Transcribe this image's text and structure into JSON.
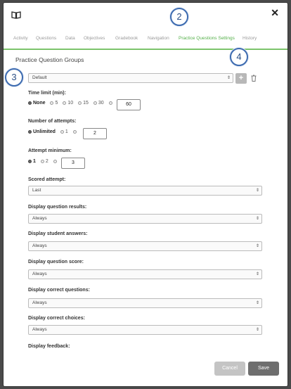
{
  "tabs": [
    "Activity",
    "Questions",
    "Data",
    "Objectives",
    "Gradebook",
    "Navigation",
    "Practice Questions Settings",
    "History"
  ],
  "callouts": [
    "2",
    "3",
    "4"
  ],
  "section_title": "Practice Question Groups",
  "group_select": "Default",
  "add_label": "+",
  "time_limit": {
    "label": "Time limit (min):",
    "options": [
      "None",
      "5",
      "10",
      "15",
      "30"
    ],
    "value": "60"
  },
  "attempts": {
    "label": "Number of attempts:",
    "options": [
      "Unlimited",
      "1"
    ],
    "value": "2"
  },
  "attempt_min": {
    "label": "Attempt minimum:",
    "options": [
      "1",
      "2"
    ],
    "value": "3"
  },
  "scored": {
    "label": "Scored attempt:",
    "value": "Last"
  },
  "dropdowns": [
    {
      "label": "Display question results:",
      "value": "Always"
    },
    {
      "label": "Display student answers:",
      "value": "Always"
    },
    {
      "label": "Display question score:",
      "value": "Always"
    },
    {
      "label": "Display correct questions:",
      "value": "Always"
    },
    {
      "label": "Display correct choices:",
      "value": "Always"
    }
  ],
  "feedback_label": "Display feedback:",
  "buttons": {
    "cancel": "Cancel",
    "save": "Save"
  },
  "colors": {
    "accent": "#55b04a",
    "callout": "#3d6bb0"
  }
}
